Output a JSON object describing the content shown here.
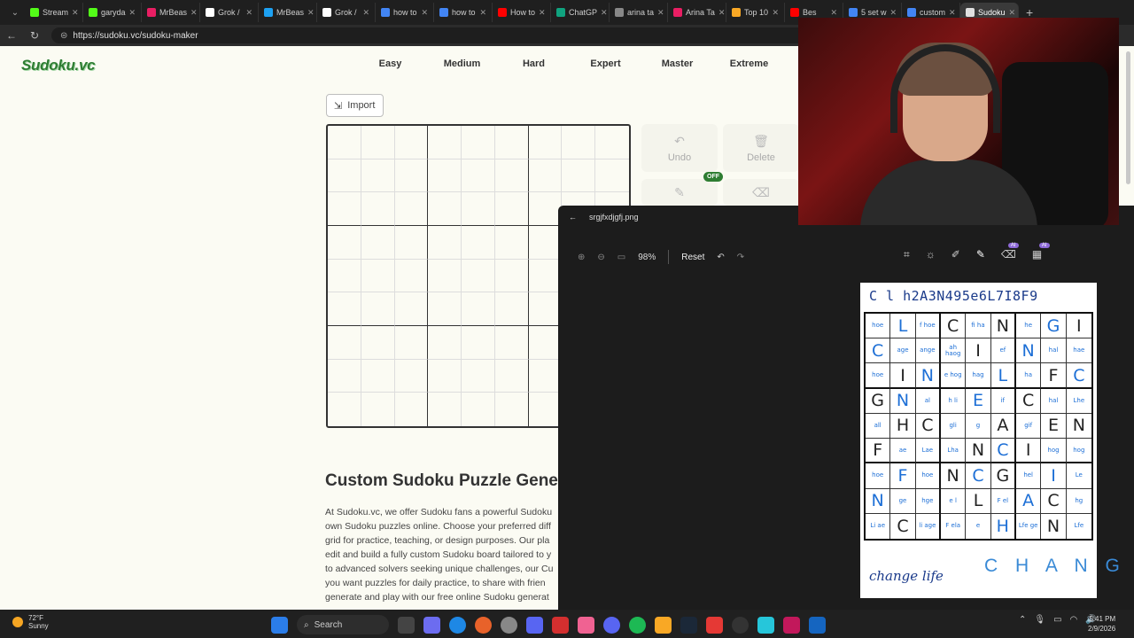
{
  "browser": {
    "tabs": [
      "Stream",
      "garyda",
      "MrBeas",
      "Grok /",
      "MrBeas",
      "Grok /",
      "how to",
      "how to",
      "How to",
      "ChatGP",
      "arina ta",
      "Arina Ta",
      "Top 10",
      "Bes",
      "5 set w",
      "custom",
      "Sudoku"
    ],
    "active_tab_index": 16,
    "url": "https://sudoku.vc/sudoku-maker"
  },
  "site": {
    "logo": "Sudoku.vc",
    "nav": [
      "Easy",
      "Medium",
      "Hard",
      "Expert",
      "Master",
      "Extreme"
    ],
    "import_label": "Import",
    "tools": {
      "undo": "Undo",
      "delete": "Delete",
      "off_badge": "OFF"
    },
    "heading": "Custom Sudoku Puzzle Gene",
    "paragraph": [
      "At Sudoku.vc, we offer Sudoku fans a powerful Sudoku",
      "own Sudoku puzzles online. Choose your preferred diff",
      "grid for practice, teaching, or design purposes. Our pla",
      "edit and build a fully custom Sudoku board tailored to y",
      "to advanced solvers seeking unique challenges, our Cu",
      "you want puzzles for daily practice, to share with frien",
      "generate and play with our free online Sudoku generat"
    ]
  },
  "viewer": {
    "filename": "srgjfxdjgfj.png",
    "zoom": "98%",
    "reset_label": "Reset",
    "ai_badge": "AI",
    "photo": {
      "top_text": "C l h2A3N495e6L7I8F9",
      "grid": [
        [
          "hoe",
          "L",
          "f hoe",
          "C",
          "fi ha",
          "N",
          "he",
          "G",
          "I"
        ],
        [
          "C",
          "age",
          "ange",
          "ah haog",
          "I",
          "ef",
          "N",
          "hal",
          "hae"
        ],
        [
          "hoe",
          "I",
          "N",
          "e hog",
          "hag",
          "L",
          "ha",
          "F",
          "C"
        ],
        [
          "G",
          "N",
          "al",
          "h li",
          "E",
          "if",
          "C",
          "hal",
          "Lhe"
        ],
        [
          "all",
          "H",
          "C",
          "gli",
          "g",
          "A",
          "gif",
          "E",
          "N"
        ],
        [
          "F",
          "ae",
          "Lae",
          "Lha",
          "N",
          "C",
          "I",
          "hog",
          "hog"
        ],
        [
          "hoe",
          "F",
          "hoe",
          "N",
          "C",
          "G",
          "hel",
          "I",
          "Le"
        ],
        [
          "N",
          "ge",
          "hge",
          "e l",
          "L",
          "F el",
          "A",
          "C",
          "hg"
        ],
        [
          "Li ae",
          "C",
          "li age",
          "F ela",
          "e",
          "H",
          "Lfe ge",
          "N",
          "Lfe"
        ]
      ],
      "note_left": "change life",
      "note_right": "C H A N G"
    }
  },
  "taskbar": {
    "temp": "72°F",
    "weather": "Sunny",
    "search": "Search",
    "time": "5:41 PM",
    "date": "2/9/2026"
  }
}
